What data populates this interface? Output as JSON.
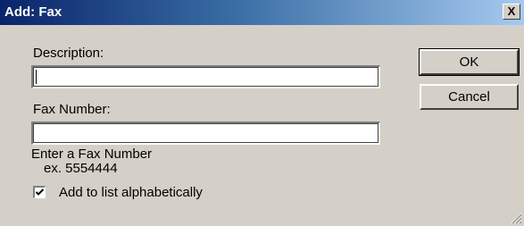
{
  "window": {
    "title": "Add: Fax",
    "close_glyph": "X"
  },
  "form": {
    "description_label": "Description:",
    "description_value": "",
    "fax_number_label": "Fax Number:",
    "fax_number_value": "",
    "hint_line1": "Enter a Fax Number",
    "hint_line2": "ex. 5554444",
    "alphabetical_label": "Add to list alphabetically",
    "alphabetical_checked": true
  },
  "buttons": {
    "ok_label": "OK",
    "cancel_label": "Cancel"
  },
  "icons": {
    "close": "close-icon",
    "checkmark": "checkmark-icon",
    "grip": "resize-grip-icon"
  }
}
